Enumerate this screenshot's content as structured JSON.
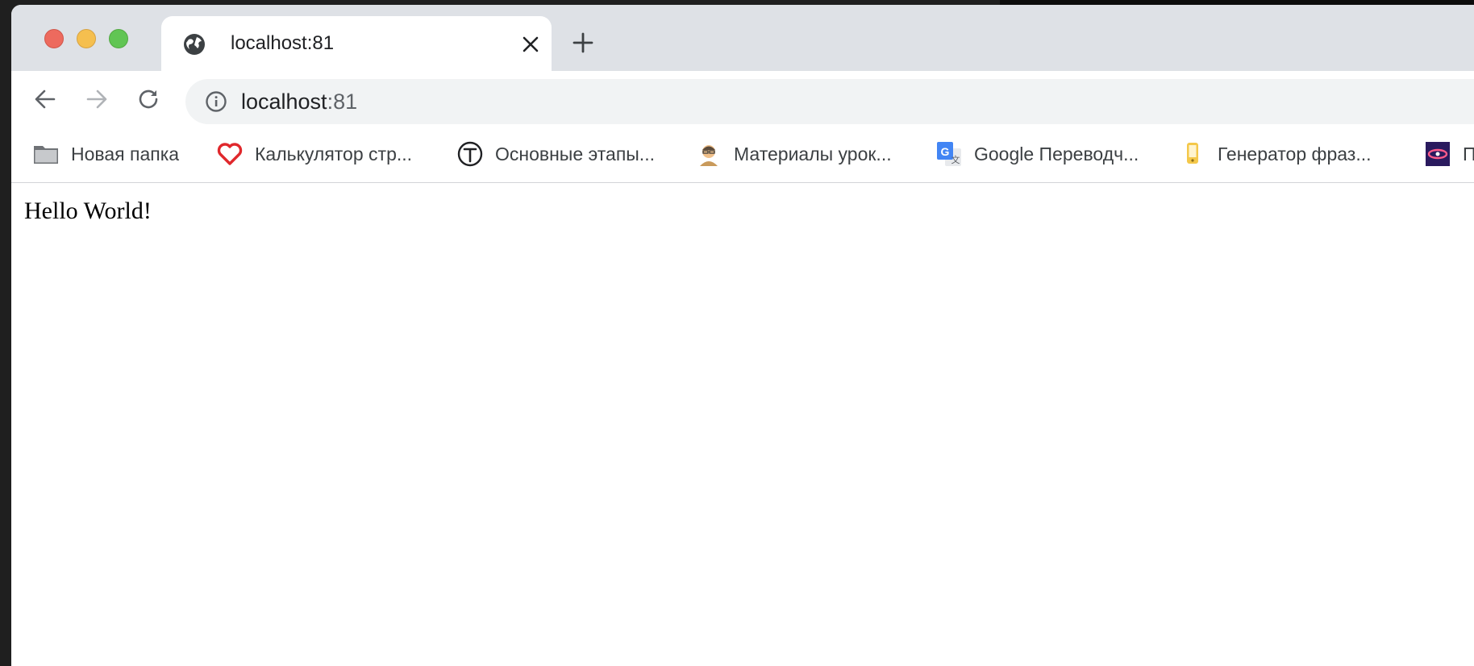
{
  "window": {
    "traffic_lights": [
      "close",
      "minimize",
      "maximize"
    ]
  },
  "tab": {
    "title": "localhost:81",
    "icon": "globe-icon"
  },
  "toolbar": {
    "url_host": "localhost",
    "url_port": ":81"
  },
  "bookmarks": [
    {
      "label": "Новая папка",
      "icon": "folder-icon"
    },
    {
      "label": "Калькулятор стр...",
      "icon": "heart-icon"
    },
    {
      "label": "Основные этапы...",
      "icon": "t-circle-icon"
    },
    {
      "label": "Материалы урок...",
      "icon": "avatar-icon"
    },
    {
      "label": "Google Переводч...",
      "icon": "google-translate-icon"
    },
    {
      "label": "Генератор фраз...",
      "icon": "phone-icon"
    },
    {
      "label": "По",
      "icon": "galaxy-icon"
    }
  ],
  "page": {
    "text": "Hello World!"
  },
  "colors": {
    "tabstrip": "#dee1e6",
    "omnibox": "#f1f3f4",
    "close": "#ed6a5e",
    "minimize": "#f5bf4f",
    "maximize": "#61c554"
  }
}
